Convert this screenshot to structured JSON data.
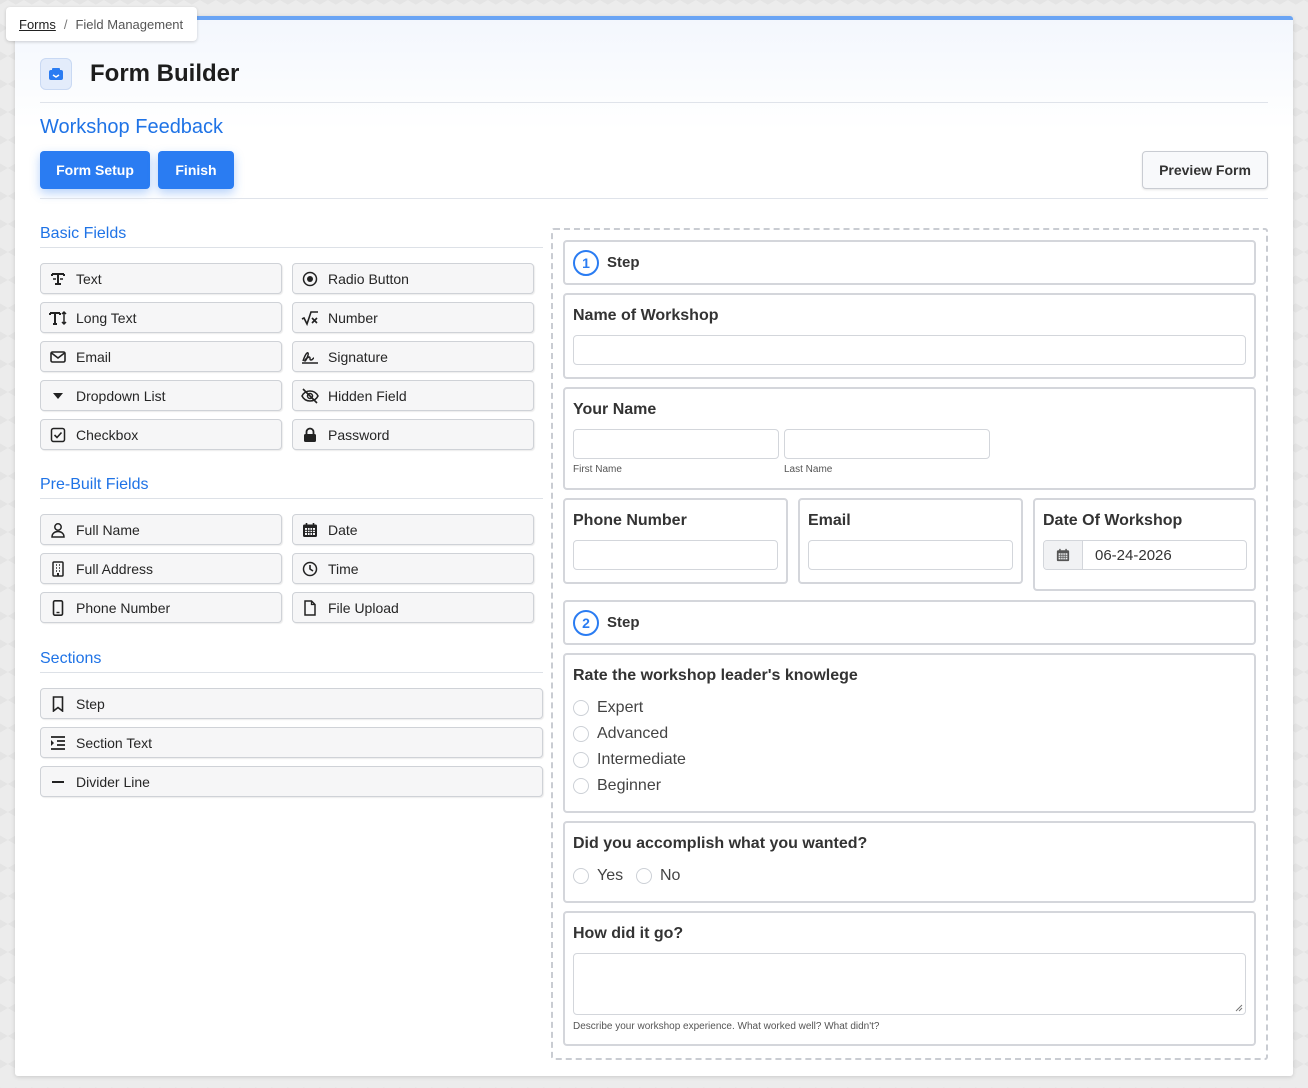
{
  "breadcrumb": {
    "root": "Forms",
    "separator": "/",
    "current": "Field Management"
  },
  "header": {
    "title": "Form Builder",
    "form_name": "Workshop Feedback"
  },
  "toolbar": {
    "setup_label": "Form Setup",
    "finish_label": "Finish",
    "preview_label": "Preview Form"
  },
  "palette": {
    "basic_title": "Basic Fields",
    "basic": [
      {
        "label": "Text",
        "icon": "text-icon"
      },
      {
        "label": "Radio Button",
        "icon": "radio-icon"
      },
      {
        "label": "Long Text",
        "icon": "long-text-icon"
      },
      {
        "label": "Number",
        "icon": "square-root-icon"
      },
      {
        "label": "Email",
        "icon": "envelope-icon"
      },
      {
        "label": "Signature",
        "icon": "signature-icon"
      },
      {
        "label": "Dropdown List",
        "icon": "caret-down-icon"
      },
      {
        "label": "Hidden Field",
        "icon": "eye-slash-icon"
      },
      {
        "label": "Checkbox",
        "icon": "checkbox-icon"
      },
      {
        "label": "Password",
        "icon": "lock-icon"
      }
    ],
    "prebuilt_title": "Pre-Built Fields",
    "prebuilt": [
      {
        "label": "Full Name",
        "icon": "user-icon"
      },
      {
        "label": "Date",
        "icon": "calendar-icon"
      },
      {
        "label": "Full Address",
        "icon": "building-icon"
      },
      {
        "label": "Time",
        "icon": "clock-icon"
      },
      {
        "label": "Phone Number",
        "icon": "mobile-icon"
      },
      {
        "label": "File Upload",
        "icon": "file-icon"
      }
    ],
    "sections_title": "Sections",
    "sections": [
      {
        "label": "Step",
        "icon": "bookmark-icon"
      },
      {
        "label": "Section Text",
        "icon": "indent-icon"
      },
      {
        "label": "Divider Line",
        "icon": "minus-icon"
      }
    ]
  },
  "form": {
    "step1": {
      "number": "1",
      "label": "Step"
    },
    "workshop_name": {
      "label": "Name of Workshop",
      "value": ""
    },
    "your_name": {
      "label": "Your Name",
      "first_label": "First Name",
      "last_label": "Last Name"
    },
    "phone": {
      "label": "Phone Number"
    },
    "email": {
      "label": "Email"
    },
    "date": {
      "label": "Date Of Workshop",
      "value": "06-24-2026"
    },
    "step2": {
      "number": "2",
      "label": "Step"
    },
    "knowledge": {
      "label": "Rate the workshop leader's knowlege",
      "options": [
        "Expert",
        "Advanced",
        "Intermediate",
        "Beginner"
      ]
    },
    "accomplish": {
      "label": "Did you accomplish what you wanted?",
      "options": [
        "Yes",
        "No"
      ]
    },
    "how": {
      "label": "How did it go?",
      "help": "Describe your workshop experience. What worked well? What didn't?"
    }
  },
  "colors": {
    "accent": "#2a7cf2",
    "link": "#1f73e6",
    "top_bar": "#6aa4f4"
  }
}
